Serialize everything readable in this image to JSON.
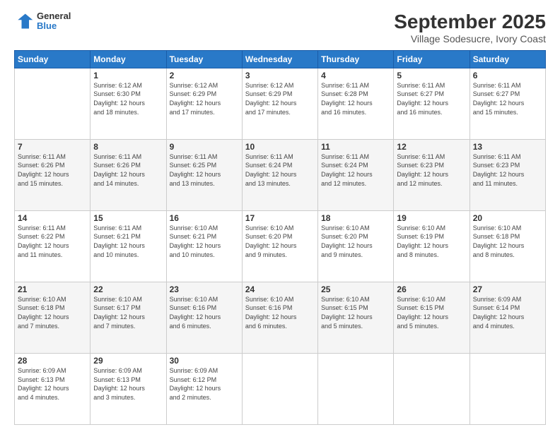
{
  "header": {
    "logo_line1": "General",
    "logo_line2": "Blue",
    "title": "September 2025",
    "subtitle": "Village Sodesucre, Ivory Coast"
  },
  "weekdays": [
    "Sunday",
    "Monday",
    "Tuesday",
    "Wednesday",
    "Thursday",
    "Friday",
    "Saturday"
  ],
  "weeks": [
    [
      {
        "day": "",
        "info": ""
      },
      {
        "day": "1",
        "info": "Sunrise: 6:12 AM\nSunset: 6:30 PM\nDaylight: 12 hours\nand 18 minutes."
      },
      {
        "day": "2",
        "info": "Sunrise: 6:12 AM\nSunset: 6:29 PM\nDaylight: 12 hours\nand 17 minutes."
      },
      {
        "day": "3",
        "info": "Sunrise: 6:12 AM\nSunset: 6:29 PM\nDaylight: 12 hours\nand 17 minutes."
      },
      {
        "day": "4",
        "info": "Sunrise: 6:11 AM\nSunset: 6:28 PM\nDaylight: 12 hours\nand 16 minutes."
      },
      {
        "day": "5",
        "info": "Sunrise: 6:11 AM\nSunset: 6:27 PM\nDaylight: 12 hours\nand 16 minutes."
      },
      {
        "day": "6",
        "info": "Sunrise: 6:11 AM\nSunset: 6:27 PM\nDaylight: 12 hours\nand 15 minutes."
      }
    ],
    [
      {
        "day": "7",
        "info": "Sunrise: 6:11 AM\nSunset: 6:26 PM\nDaylight: 12 hours\nand 15 minutes."
      },
      {
        "day": "8",
        "info": "Sunrise: 6:11 AM\nSunset: 6:26 PM\nDaylight: 12 hours\nand 14 minutes."
      },
      {
        "day": "9",
        "info": "Sunrise: 6:11 AM\nSunset: 6:25 PM\nDaylight: 12 hours\nand 13 minutes."
      },
      {
        "day": "10",
        "info": "Sunrise: 6:11 AM\nSunset: 6:24 PM\nDaylight: 12 hours\nand 13 minutes."
      },
      {
        "day": "11",
        "info": "Sunrise: 6:11 AM\nSunset: 6:24 PM\nDaylight: 12 hours\nand 12 minutes."
      },
      {
        "day": "12",
        "info": "Sunrise: 6:11 AM\nSunset: 6:23 PM\nDaylight: 12 hours\nand 12 minutes."
      },
      {
        "day": "13",
        "info": "Sunrise: 6:11 AM\nSunset: 6:23 PM\nDaylight: 12 hours\nand 11 minutes."
      }
    ],
    [
      {
        "day": "14",
        "info": "Sunrise: 6:11 AM\nSunset: 6:22 PM\nDaylight: 12 hours\nand 11 minutes."
      },
      {
        "day": "15",
        "info": "Sunrise: 6:11 AM\nSunset: 6:21 PM\nDaylight: 12 hours\nand 10 minutes."
      },
      {
        "day": "16",
        "info": "Sunrise: 6:10 AM\nSunset: 6:21 PM\nDaylight: 12 hours\nand 10 minutes."
      },
      {
        "day": "17",
        "info": "Sunrise: 6:10 AM\nSunset: 6:20 PM\nDaylight: 12 hours\nand 9 minutes."
      },
      {
        "day": "18",
        "info": "Sunrise: 6:10 AM\nSunset: 6:20 PM\nDaylight: 12 hours\nand 9 minutes."
      },
      {
        "day": "19",
        "info": "Sunrise: 6:10 AM\nSunset: 6:19 PM\nDaylight: 12 hours\nand 8 minutes."
      },
      {
        "day": "20",
        "info": "Sunrise: 6:10 AM\nSunset: 6:18 PM\nDaylight: 12 hours\nand 8 minutes."
      }
    ],
    [
      {
        "day": "21",
        "info": "Sunrise: 6:10 AM\nSunset: 6:18 PM\nDaylight: 12 hours\nand 7 minutes."
      },
      {
        "day": "22",
        "info": "Sunrise: 6:10 AM\nSunset: 6:17 PM\nDaylight: 12 hours\nand 7 minutes."
      },
      {
        "day": "23",
        "info": "Sunrise: 6:10 AM\nSunset: 6:16 PM\nDaylight: 12 hours\nand 6 minutes."
      },
      {
        "day": "24",
        "info": "Sunrise: 6:10 AM\nSunset: 6:16 PM\nDaylight: 12 hours\nand 6 minutes."
      },
      {
        "day": "25",
        "info": "Sunrise: 6:10 AM\nSunset: 6:15 PM\nDaylight: 12 hours\nand 5 minutes."
      },
      {
        "day": "26",
        "info": "Sunrise: 6:10 AM\nSunset: 6:15 PM\nDaylight: 12 hours\nand 5 minutes."
      },
      {
        "day": "27",
        "info": "Sunrise: 6:09 AM\nSunset: 6:14 PM\nDaylight: 12 hours\nand 4 minutes."
      }
    ],
    [
      {
        "day": "28",
        "info": "Sunrise: 6:09 AM\nSunset: 6:13 PM\nDaylight: 12 hours\nand 4 minutes."
      },
      {
        "day": "29",
        "info": "Sunrise: 6:09 AM\nSunset: 6:13 PM\nDaylight: 12 hours\nand 3 minutes."
      },
      {
        "day": "30",
        "info": "Sunrise: 6:09 AM\nSunset: 6:12 PM\nDaylight: 12 hours\nand 2 minutes."
      },
      {
        "day": "",
        "info": ""
      },
      {
        "day": "",
        "info": ""
      },
      {
        "day": "",
        "info": ""
      },
      {
        "day": "",
        "info": ""
      }
    ]
  ]
}
